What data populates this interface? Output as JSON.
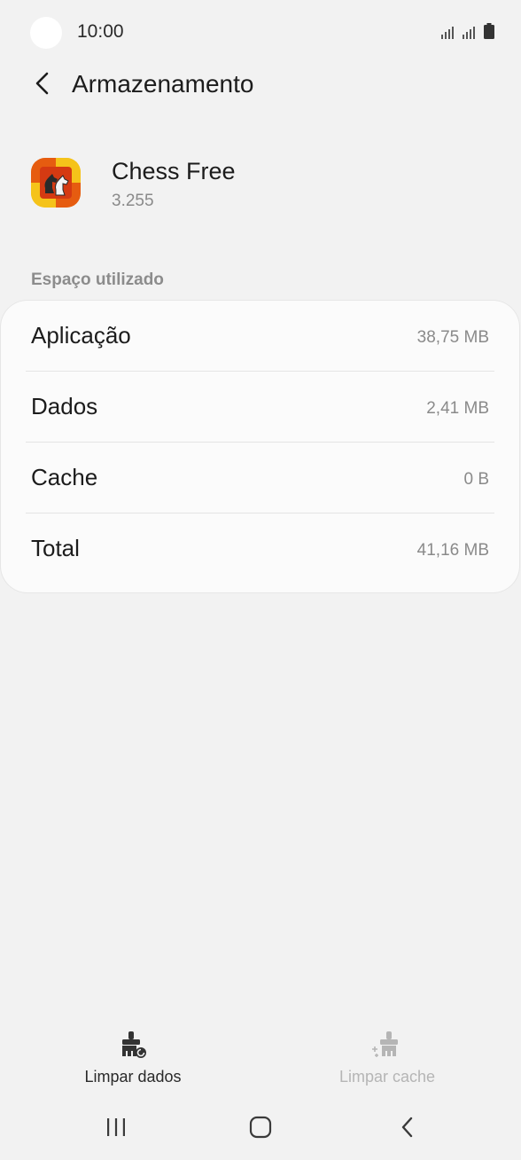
{
  "status_bar": {
    "time": "10:00"
  },
  "header": {
    "title": "Armazenamento"
  },
  "app": {
    "name": "Chess Free",
    "version": "3.255"
  },
  "section": {
    "label": "Espaço utilizado"
  },
  "storage": {
    "rows": [
      {
        "label": "Aplicação",
        "value": "38,75 MB"
      },
      {
        "label": "Dados",
        "value": "2,41 MB"
      },
      {
        "label": "Cache",
        "value": "0 B"
      },
      {
        "label": "Total",
        "value": "41,16 MB"
      }
    ]
  },
  "actions": {
    "clear_data": {
      "label": "Limpar dados",
      "icon": "clear-data-icon",
      "enabled": true
    },
    "clear_cache": {
      "label": "Limpar cache",
      "icon": "clear-cache-icon",
      "enabled": false
    }
  },
  "nav": {
    "icons": [
      "recents-icon",
      "home-icon",
      "back-icon"
    ]
  },
  "colors": {
    "background": "#f2f2f2",
    "card": "#fbfbfb",
    "text_primary": "#1c1c1c",
    "text_secondary": "#8a8a8a",
    "disabled": "#b5b5b5"
  }
}
